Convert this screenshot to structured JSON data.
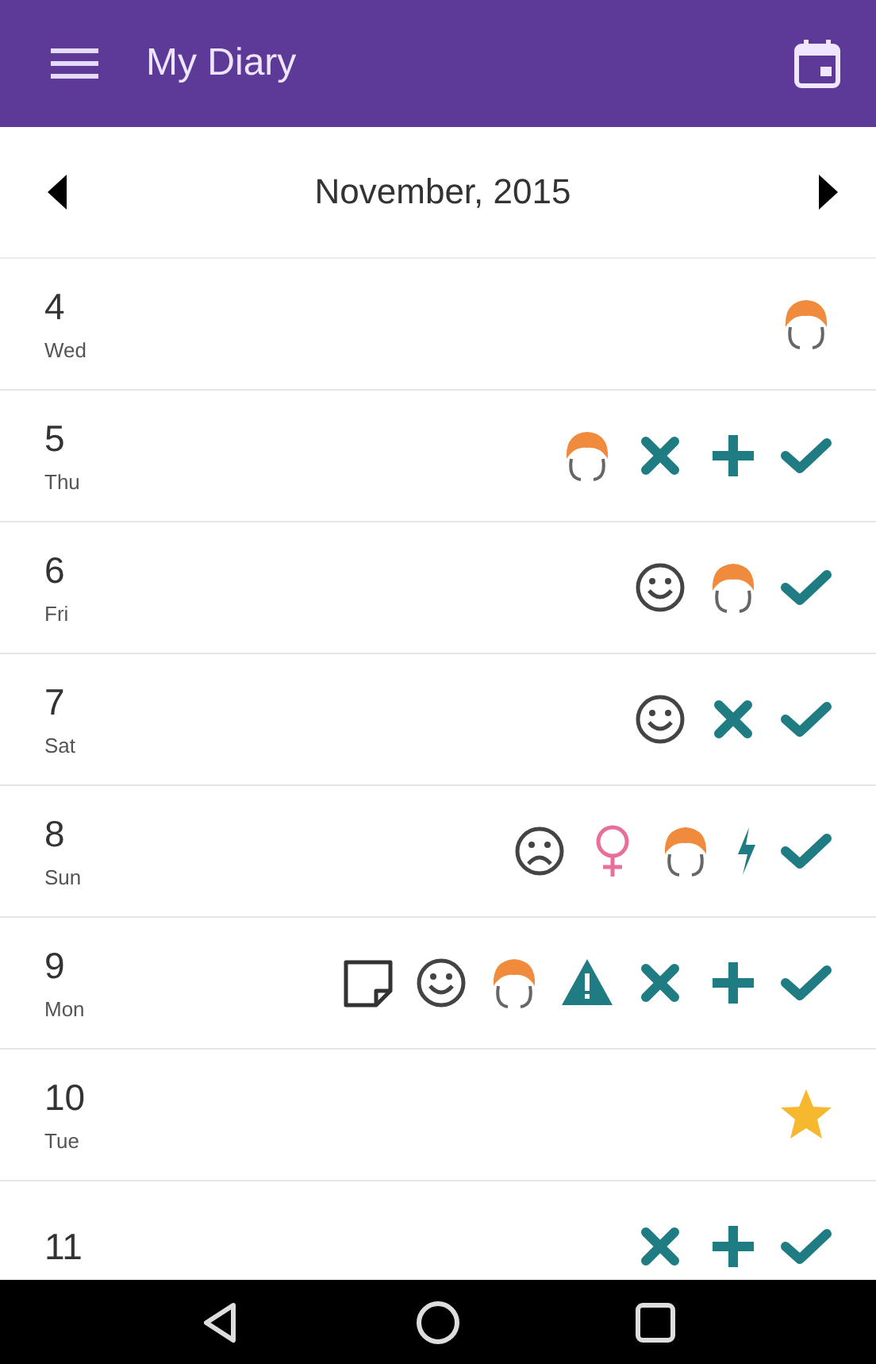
{
  "app_bar": {
    "title": "My Diary"
  },
  "month_nav": {
    "label": "November, 2015"
  },
  "days": [
    {
      "number": "4",
      "weekday": "Wed",
      "entries": [
        {
          "kind": "head"
        }
      ]
    },
    {
      "number": "5",
      "weekday": "Thu",
      "entries": [
        {
          "kind": "head"
        },
        {
          "kind": "cross"
        },
        {
          "kind": "plus"
        },
        {
          "kind": "check"
        }
      ]
    },
    {
      "number": "6",
      "weekday": "Fri",
      "entries": [
        {
          "kind": "smile"
        },
        {
          "kind": "head"
        },
        {
          "kind": "check"
        }
      ]
    },
    {
      "number": "7",
      "weekday": "Sat",
      "entries": [
        {
          "kind": "smile"
        },
        {
          "kind": "cross"
        },
        {
          "kind": "check"
        }
      ]
    },
    {
      "number": "8",
      "weekday": "Sun",
      "entries": [
        {
          "kind": "frown"
        },
        {
          "kind": "female"
        },
        {
          "kind": "head"
        },
        {
          "kind": "bolt"
        },
        {
          "kind": "check"
        }
      ]
    },
    {
      "number": "9",
      "weekday": "Mon",
      "entries": [
        {
          "kind": "note"
        },
        {
          "kind": "smile"
        },
        {
          "kind": "head"
        },
        {
          "kind": "warning"
        },
        {
          "kind": "cross"
        },
        {
          "kind": "plus"
        },
        {
          "kind": "check"
        }
      ]
    },
    {
      "number": "10",
      "weekday": "Tue",
      "entries": [
        {
          "kind": "star"
        }
      ]
    },
    {
      "number": "11",
      "entries": [
        {
          "kind": "cross"
        },
        {
          "kind": "plus"
        },
        {
          "kind": "check"
        }
      ]
    }
  ]
}
